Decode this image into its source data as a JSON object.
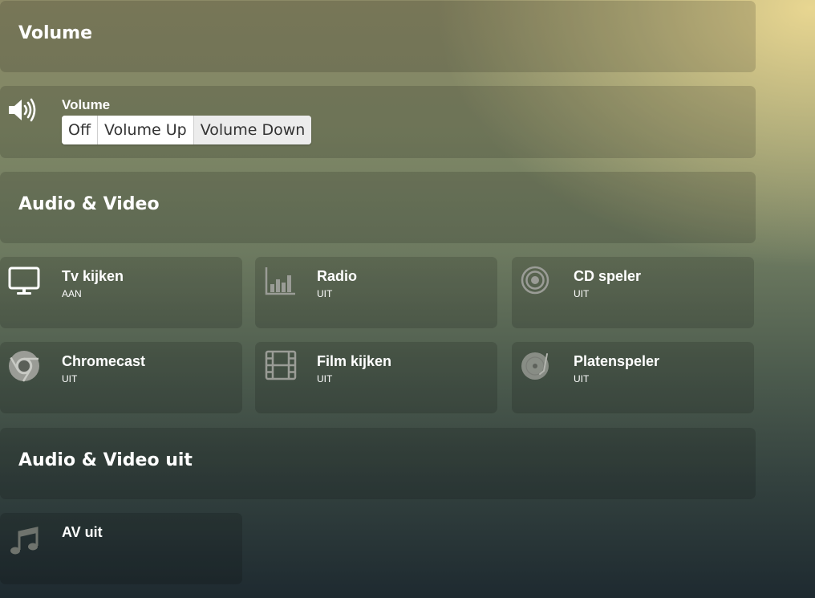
{
  "sections": {
    "volume_header": "Volume",
    "av_header": "Audio & Video",
    "av_off_header": "Audio & Video uit"
  },
  "volume_control": {
    "label": "Volume",
    "icon": "volume-up-icon",
    "buttons": [
      "Off",
      "Volume Up",
      "Volume Down"
    ]
  },
  "av_devices": [
    {
      "name": "Tv kijken",
      "status": "AAN",
      "icon": "tv-icon"
    },
    {
      "name": "Radio",
      "status": "UIT",
      "icon": "bar-chart-icon"
    },
    {
      "name": "CD speler",
      "status": "UIT",
      "icon": "cd-icon"
    },
    {
      "name": "Chromecast",
      "status": "UIT",
      "icon": "chrome-icon"
    },
    {
      "name": "Film kijken",
      "status": "UIT",
      "icon": "film-icon"
    },
    {
      "name": "Platenspeler",
      "status": "UIT",
      "icon": "record-player-icon"
    }
  ],
  "av_off": {
    "name": "AV uit",
    "icon": "music-note-icon"
  },
  "colors": {
    "icon_on": "#ffffff",
    "icon_off": "#9a9c96",
    "text": "#ffffff"
  }
}
